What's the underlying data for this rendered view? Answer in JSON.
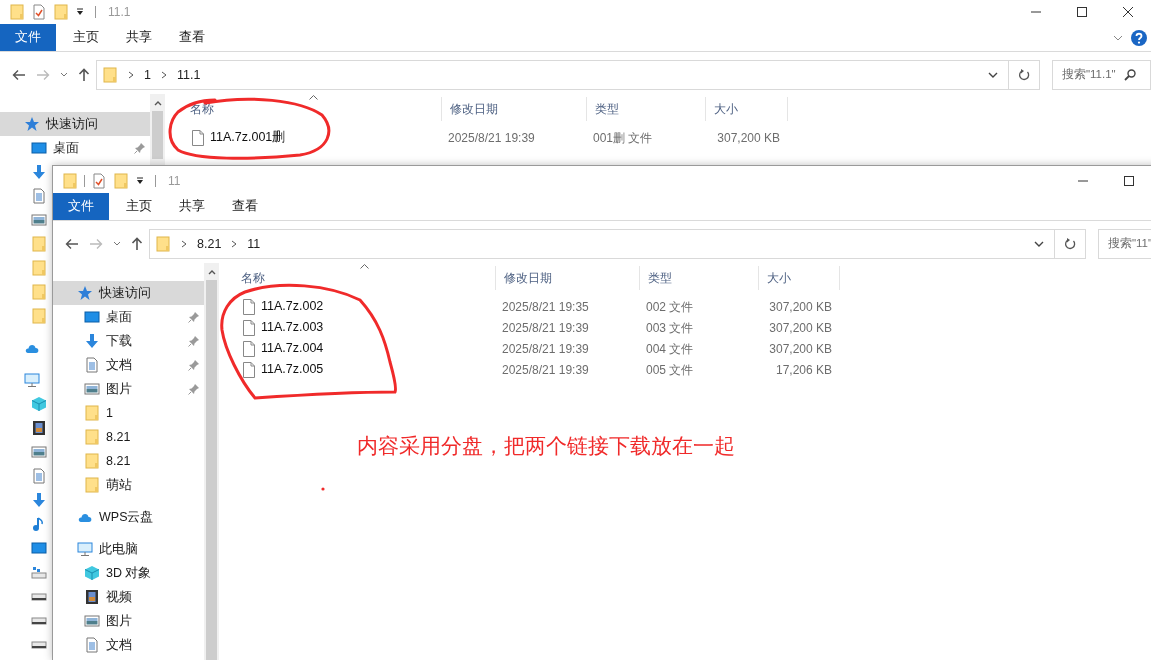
{
  "windows": [
    {
      "title": "11.1",
      "ribbon_tabs": [
        {
          "label": "文件",
          "selected": true
        },
        {
          "label": "主页",
          "selected": false
        },
        {
          "label": "共享",
          "selected": false
        },
        {
          "label": "查看",
          "selected": false
        }
      ],
      "path": [
        "1",
        "11.1"
      ],
      "search_placeholder": "搜索\"11.1\"",
      "nav": [
        {
          "kind": "star",
          "label": "快速访问",
          "selected": true,
          "children": [
            {
              "kind": "desktop",
              "label": "桌面",
              "pinned": true
            },
            {
              "kind": "download"
            },
            {
              "kind": "document"
            },
            {
              "kind": "picture"
            },
            {
              "kind": "folder"
            },
            {
              "kind": "folder"
            },
            {
              "kind": "folder"
            },
            {
              "kind": "folder"
            }
          ]
        },
        {
          "kind": "cloud",
          "selected": false
        },
        {
          "kind": "pc",
          "selected": false,
          "children": [
            {
              "kind": "cube"
            },
            {
              "kind": "video"
            },
            {
              "kind": "picture"
            },
            {
              "kind": "document"
            },
            {
              "kind": "download"
            },
            {
              "kind": "music"
            },
            {
              "kind": "desktop"
            },
            {
              "kind": "netdrive"
            },
            {
              "kind": "drive"
            },
            {
              "kind": "drive"
            },
            {
              "kind": "drive"
            }
          ]
        }
      ],
      "columns": [
        "名称",
        "修改日期",
        "类型",
        "大小"
      ],
      "rows": [
        {
          "name": "11A.7z.001删",
          "modified": "2025/8/21 19:39",
          "type": "001删 文件",
          "size": "307,200 KB"
        }
      ]
    },
    {
      "title": "11",
      "ribbon_tabs": [
        {
          "label": "文件",
          "selected": true
        },
        {
          "label": "主页",
          "selected": false
        },
        {
          "label": "共享",
          "selected": false
        },
        {
          "label": "查看",
          "selected": false
        }
      ],
      "path": [
        "8.21",
        "11"
      ],
      "search_placeholder": "搜索\"11\"",
      "nav": [
        {
          "kind": "star",
          "label": "快速访问",
          "selected": true,
          "children": [
            {
              "kind": "desktop",
              "label": "桌面",
              "pinned": true
            },
            {
              "kind": "download",
              "label": "下载",
              "pinned": true
            },
            {
              "kind": "document",
              "label": "文档",
              "pinned": true
            },
            {
              "kind": "picture",
              "label": "图片",
              "pinned": true
            },
            {
              "kind": "folder",
              "label": "1",
              "pinned": false
            },
            {
              "kind": "folder",
              "label": "8.21",
              "pinned": false
            },
            {
              "kind": "folder",
              "label": "8.21",
              "pinned": false
            },
            {
              "kind": "folder",
              "label": "萌站",
              "pinned": false
            }
          ]
        },
        {
          "kind": "cloud",
          "label": "WPS云盘",
          "selected": false
        },
        {
          "kind": "pc",
          "label": "此电脑",
          "selected": false,
          "children": [
            {
              "kind": "cube",
              "label": "3D 对象"
            },
            {
              "kind": "video",
              "label": "视频"
            },
            {
              "kind": "picture",
              "label": "图片"
            },
            {
              "kind": "document",
              "label": "文档"
            }
          ]
        }
      ],
      "columns": [
        "名称",
        "修改日期",
        "类型",
        "大小"
      ],
      "rows": [
        {
          "name": "11A.7z.002",
          "modified": "2025/8/21 19:35",
          "type": "002 文件",
          "size": "307,200 KB"
        },
        {
          "name": "11A.7z.003",
          "modified": "2025/8/21 19:39",
          "type": "003 文件",
          "size": "307,200 KB"
        },
        {
          "name": "11A.7z.004",
          "modified": "2025/8/21 19:39",
          "type": "004 文件",
          "size": "307,200 KB"
        },
        {
          "name": "11A.7z.005",
          "modified": "2025/8/21 19:39",
          "type": "005 文件",
          "size": "17,206 KB"
        }
      ]
    }
  ],
  "annotation": {
    "note": "内容采用分盘，把两个链接下载放在一起"
  }
}
